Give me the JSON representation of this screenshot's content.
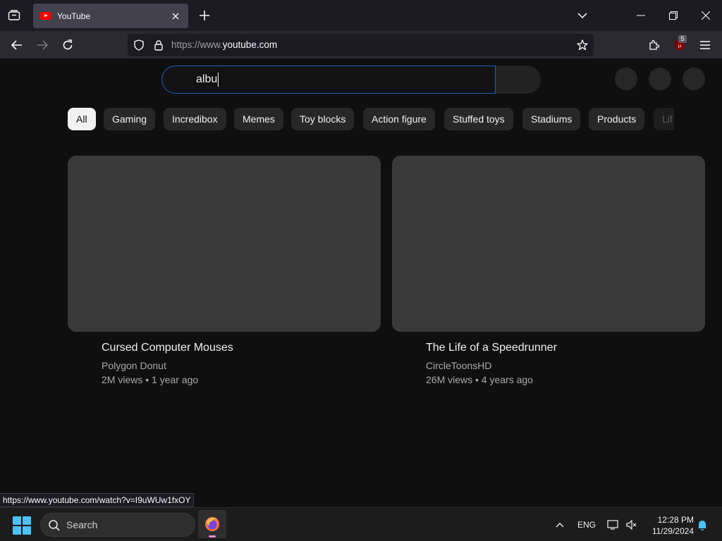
{
  "browser": {
    "tab": {
      "title": "YouTube"
    },
    "url": {
      "prefix": "https://www.",
      "domain": "youtube.com"
    },
    "extension_badge": "5",
    "status_url": "https://www.youtube.com/watch?v=I9uWUw1fxOY"
  },
  "youtube": {
    "search": {
      "value": "albu"
    },
    "chips": [
      "All",
      "Gaming",
      "Incredibox",
      "Memes",
      "Toy blocks",
      "Action figure",
      "Stuffed toys",
      "Stadiums",
      "Products",
      "Lif"
    ],
    "videos": [
      {
        "title": "Cursed Computer Mouses",
        "channel": "Polygon Donut",
        "meta": "2M views • 1 year ago"
      },
      {
        "title": "The Life of a Speedrunner",
        "channel": "CircleToonsHD",
        "meta": "26M views • 4 years ago"
      }
    ]
  },
  "taskbar": {
    "search_label": "Search",
    "language": "ENG",
    "time": "12:28 PM",
    "date": "11/29/2024"
  },
  "colors": {
    "accent_blue": "#1c62b9",
    "youtube_red": "#ff0000",
    "windows_blue": "#4cc2ff"
  }
}
